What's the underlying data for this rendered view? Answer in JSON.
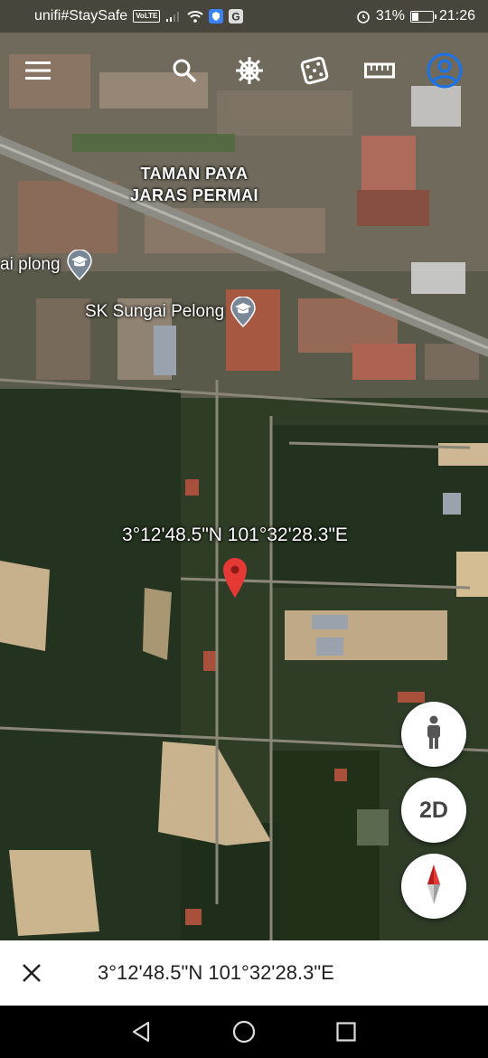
{
  "status_bar": {
    "carrier": "unifi#StaySafe",
    "volte": "VoLTE",
    "signal_extra": "..",
    "battery_percent": "31%",
    "time": "21:26",
    "battery_level": 0.31
  },
  "toolbar": {
    "icons": [
      "menu-icon",
      "search-icon",
      "voyager-wheel-icon",
      "dice-icon",
      "ruler-icon",
      "account-icon"
    ]
  },
  "map": {
    "place_label_line1": "TAMAN PAYA",
    "place_label_line2": "JARAS PERMAI",
    "poi_school_partial": "ai plong",
    "poi_school": "SK Sungai Pelong",
    "pin_coordinates": "3°12'48.5\"N 101°32'28.3\"E"
  },
  "floating_buttons": {
    "pegman_icon": "pegman-icon",
    "view_mode_label": "2D",
    "compass_icon": "compass-icon"
  },
  "info_bar": {
    "coordinates": "3°12'48.5\"N 101°32'28.3\"E"
  },
  "nav_bar": {
    "icons": [
      "back-icon",
      "home-icon",
      "recents-icon"
    ]
  },
  "colors": {
    "accent_blue": "#1a73e8",
    "pin_red": "#e53935",
    "info_bar_bg": "#ffffff"
  }
}
